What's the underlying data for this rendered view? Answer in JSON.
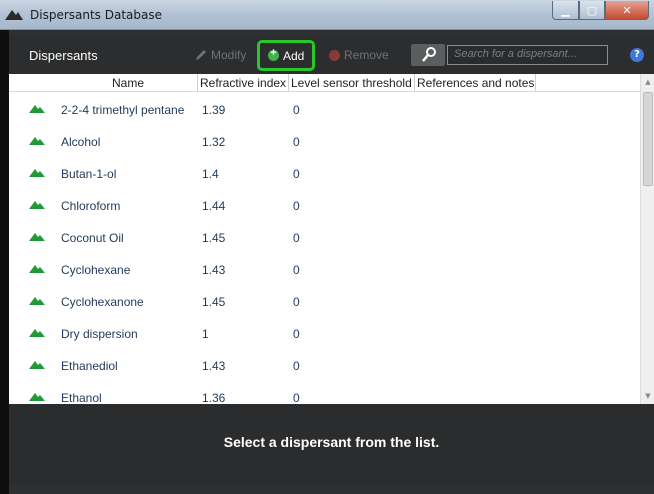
{
  "window": {
    "title": "Dispersants Database"
  },
  "toolbar": {
    "title": "Dispersants",
    "modify_label": "Modify",
    "add_label": "Add",
    "remove_label": "Remove",
    "search_placeholder": "Search for a dispersant..."
  },
  "table": {
    "columns": [
      "Name",
      "Refractive index",
      "Level sensor threshold",
      "References and notes"
    ],
    "rows": [
      {
        "name": "2-2-4 trimethyl pentane",
        "ri": "1.39",
        "threshold": "0",
        "notes": ""
      },
      {
        "name": "Alcohol",
        "ri": "1.32",
        "threshold": "0",
        "notes": ""
      },
      {
        "name": "Butan-1-ol",
        "ri": "1.4",
        "threshold": "0",
        "notes": ""
      },
      {
        "name": "Chloroform",
        "ri": "1.44",
        "threshold": "0",
        "notes": ""
      },
      {
        "name": "Coconut Oil",
        "ri": "1.45",
        "threshold": "0",
        "notes": ""
      },
      {
        "name": "Cyclohexane",
        "ri": "1.43",
        "threshold": "0",
        "notes": ""
      },
      {
        "name": "Cyclohexanone",
        "ri": "1.45",
        "threshold": "0",
        "notes": ""
      },
      {
        "name": "Dry dispersion",
        "ri": "1",
        "threshold": "0",
        "notes": ""
      },
      {
        "name": "Ethanediol",
        "ri": "1.43",
        "threshold": "0",
        "notes": ""
      },
      {
        "name": "Ethanol",
        "ri": "1.36",
        "threshold": "0",
        "notes": ""
      }
    ]
  },
  "footer": {
    "message": "Select a dispersant from the list."
  },
  "icons": {
    "app": "mountain-icon",
    "modify": "pencil-icon",
    "add": "plus-circle-icon",
    "remove": "minus-circle-icon",
    "search": "magnifier-icon",
    "help": "help-icon",
    "row": "mountain-icon"
  },
  "colors": {
    "add_highlight": "#2cc52c",
    "row_icon": "#1f9a3b"
  }
}
